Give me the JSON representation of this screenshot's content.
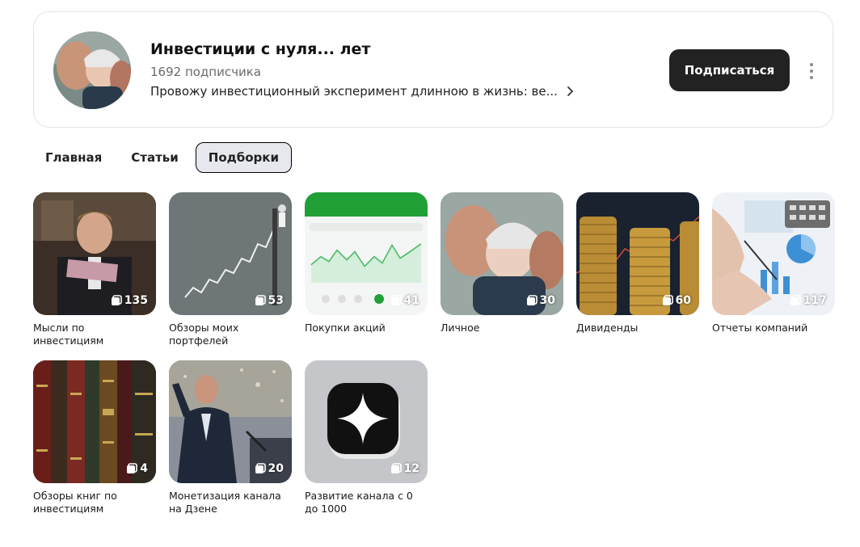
{
  "channel": {
    "title": "Инвестиции с нуля... лет",
    "subscribers": "1692 подписчика",
    "description": "Провожу инвестиционный эксперимент длинною в жизнь: ве...",
    "subscribe_label": "Подписаться",
    "more_icon": "more-vertical-icon"
  },
  "tabs": [
    {
      "label": "Главная",
      "active": false
    },
    {
      "label": "Статьи",
      "active": false
    },
    {
      "label": "Подборки",
      "active": true
    }
  ],
  "collections": [
    {
      "label": "Мысли по инвестициям",
      "count": "135"
    },
    {
      "label": "Обзоры моих портфелей",
      "count": "53"
    },
    {
      "label": "Покупки акций",
      "count": "41"
    },
    {
      "label": "Личное",
      "count": "30"
    },
    {
      "label": "Дивиденды",
      "count": "60"
    },
    {
      "label": "Отчеты компаний",
      "count": "117"
    },
    {
      "label": "Обзоры книг по инвестициям",
      "count": "4"
    },
    {
      "label": "Монетизация канала на Дзене",
      "count": "20"
    },
    {
      "label": "Развитие канала с 0 до 1000",
      "count": "12"
    }
  ],
  "colors": {
    "subscribe_bg": "#222222",
    "active_tab_bg": "#e6e8ee"
  }
}
